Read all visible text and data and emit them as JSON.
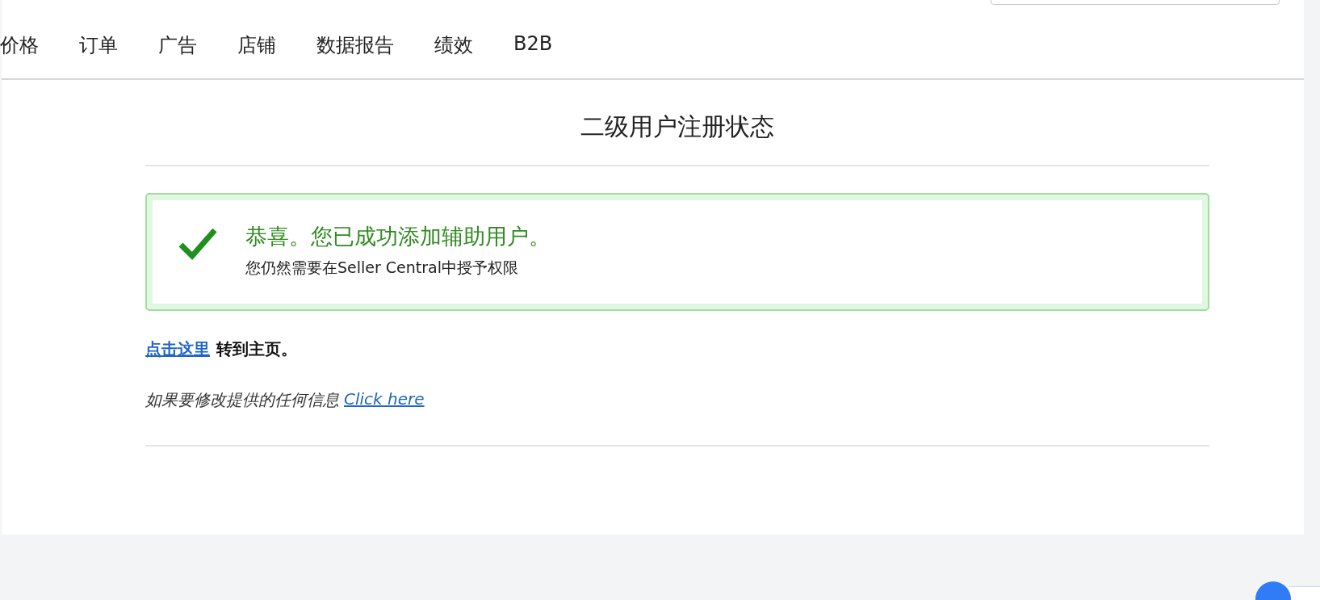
{
  "nav": {
    "items": [
      {
        "label": "价格"
      },
      {
        "label": "订单"
      },
      {
        "label": "广告"
      },
      {
        "label": "店铺"
      },
      {
        "label": "数据报告"
      },
      {
        "label": "绩效"
      },
      {
        "label": "B2B"
      }
    ]
  },
  "page": {
    "title": "二级用户注册状态",
    "alert": {
      "kind": "success",
      "heading": "恭喜。您已成功添加辅助用户。",
      "message": "您仍然需要在Seller Central中授予权限"
    },
    "home_line": {
      "link": "点击这里",
      "text": "转到主页。"
    },
    "edit_line": {
      "text": "如果要修改提供的任何信息",
      "link": "Click here"
    }
  }
}
